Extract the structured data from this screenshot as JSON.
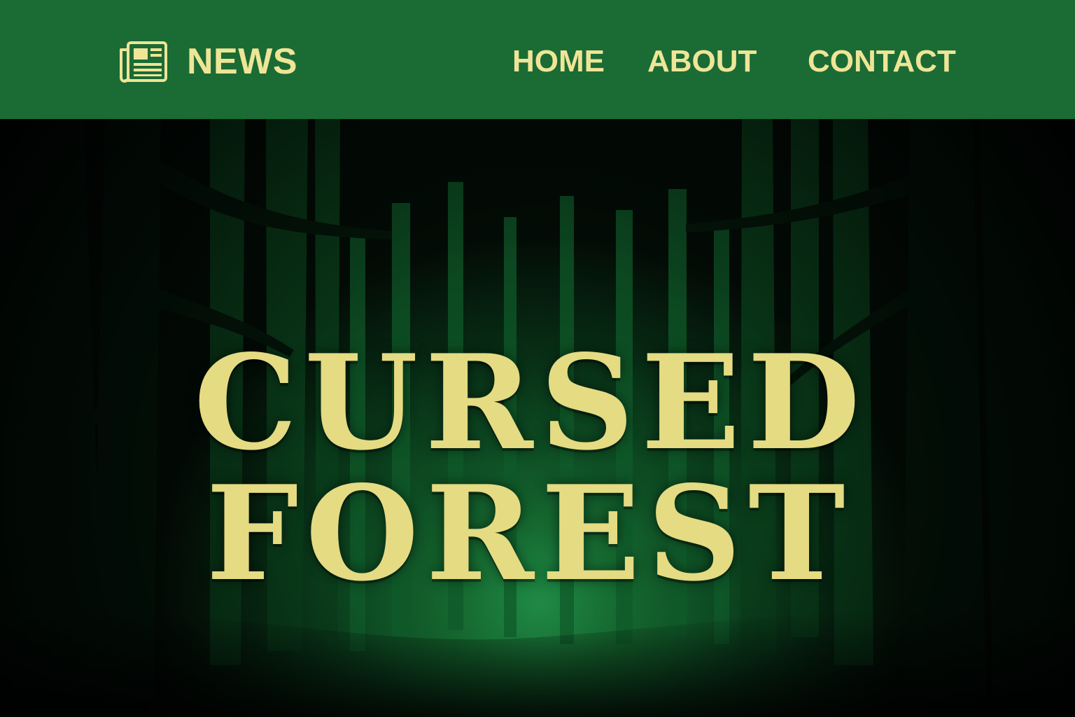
{
  "header": {
    "brand_label": "NEWS",
    "brand_icon": "newspaper-icon",
    "background_color": "#1b6b35",
    "text_color": "#efe597"
  },
  "nav": {
    "items": [
      {
        "label": "HOME"
      },
      {
        "label": "ABOUT"
      },
      {
        "label": "CONTACT"
      }
    ]
  },
  "hero": {
    "title_line1": "CURSED",
    "title_line2": "FOREST",
    "title_color": "#e4db83",
    "glow_color": "#1f8a45"
  }
}
